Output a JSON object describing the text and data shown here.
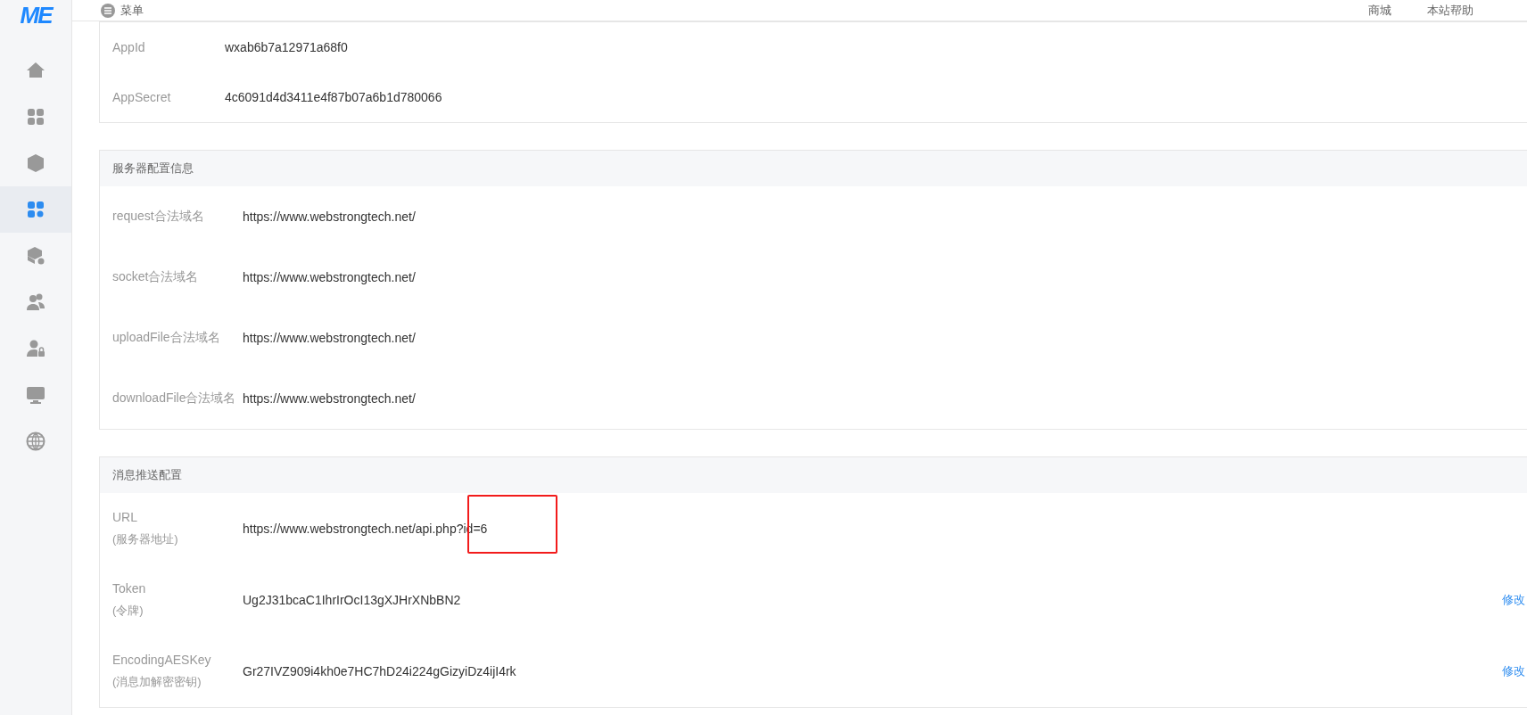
{
  "sidebar": {
    "logo": "ME",
    "items": [
      {
        "selected": false
      },
      {
        "selected": false
      },
      {
        "selected": false
      },
      {
        "selected": true
      },
      {
        "selected": false
      },
      {
        "selected": false
      },
      {
        "selected": false
      },
      {
        "selected": false
      },
      {
        "selected": false
      }
    ]
  },
  "header": {
    "menu": "菜单",
    "links": [
      "商城",
      "本站帮助"
    ]
  },
  "app_card": {
    "rows": [
      {
        "label": "AppId",
        "value": "wxab6b7a12971a68f0"
      },
      {
        "label": "AppSecret",
        "value": "4c6091d4d3411e4f87b07a6b1d780066"
      }
    ]
  },
  "server_card": {
    "title": "服务器配置信息",
    "rows": [
      {
        "label": "request合法域名",
        "value": "https://www.webstrongtech.net/"
      },
      {
        "label": "socket合法域名",
        "value": "https://www.webstrongtech.net/"
      },
      {
        "label": "uploadFile合法域名",
        "value": "https://www.webstrongtech.net/"
      },
      {
        "label": "downloadFile合法域名",
        "value": "https://www.webstrongtech.net/"
      }
    ]
  },
  "push_card": {
    "title": "消息推送配置",
    "rows": [
      {
        "label": "URL",
        "sublabel": "(服务器地址)",
        "value": "https://www.webstrongtech.net/api.php?id=6"
      },
      {
        "label": "Token",
        "sublabel": "(令牌)",
        "value": "Ug2J31bcaC1IhrIrOcI13gXJHrXNbBN2",
        "action": "修改"
      },
      {
        "label": "EncodingAESKey",
        "sublabel": "(消息加解密密钥)",
        "value": "Gr27IVZ909i4kh0e7HC7hD24i224gGizyiDz4ijI4rk",
        "action": "修改"
      }
    ],
    "annotation": {
      "kind": "rectangle"
    }
  }
}
